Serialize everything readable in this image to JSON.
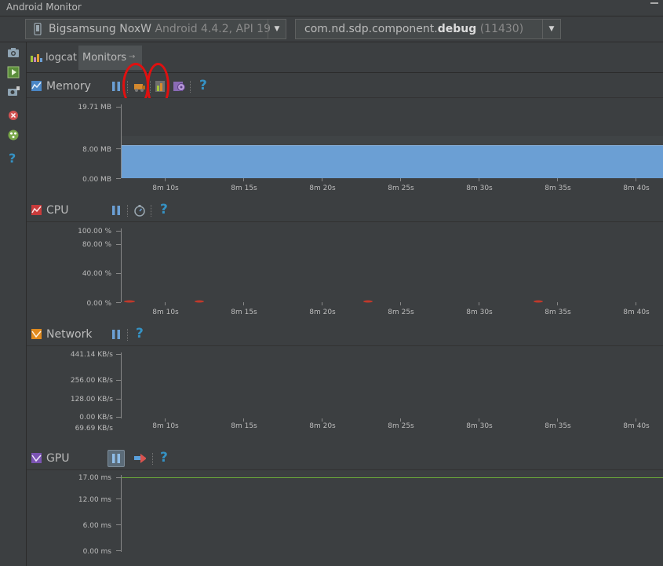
{
  "window": {
    "title": "Android Monitor"
  },
  "device_selector": {
    "device": "Bigsamsung NoxW",
    "detail": "Android 4.4.2, API 19"
  },
  "process_selector": {
    "prefix": "com.nd.sdp.component.",
    "bold": "debug",
    "pid": "(11430)"
  },
  "tabs": [
    {
      "label": "logcat"
    },
    {
      "label": "Monitors"
    }
  ],
  "monitors": {
    "memory": {
      "title": "Memory",
      "y_labels": [
        "19.71 MB",
        "8.00 MB",
        "0.00 MB"
      ]
    },
    "cpu": {
      "title": "CPU",
      "y_labels": [
        "100.00 %",
        "80.00 %",
        "40.00 %",
        "0.00 %"
      ]
    },
    "network": {
      "title": "Network",
      "y_labels": [
        "441.14 KB/s",
        "256.00 KB/s",
        "128.00 KB/s",
        "0.00 KB/s",
        "69.69 KB/s"
      ]
    },
    "gpu": {
      "title": "GPU",
      "y_labels": [
        "17.00 ms",
        "12.00 ms",
        "6.00 ms",
        "0.00 ms"
      ]
    }
  },
  "time_axis": [
    "8m 10s",
    "8m 15s",
    "8m 20s",
    "8m 25s",
    "8m 30s",
    "8m 35s",
    "8m 40s"
  ],
  "help_glyph": "?",
  "colors": {
    "memory_fill": "#6b9fd4",
    "gpu_line": "#6ba83a",
    "cpu_line": "#c0392b",
    "annotation": "#e01010"
  }
}
